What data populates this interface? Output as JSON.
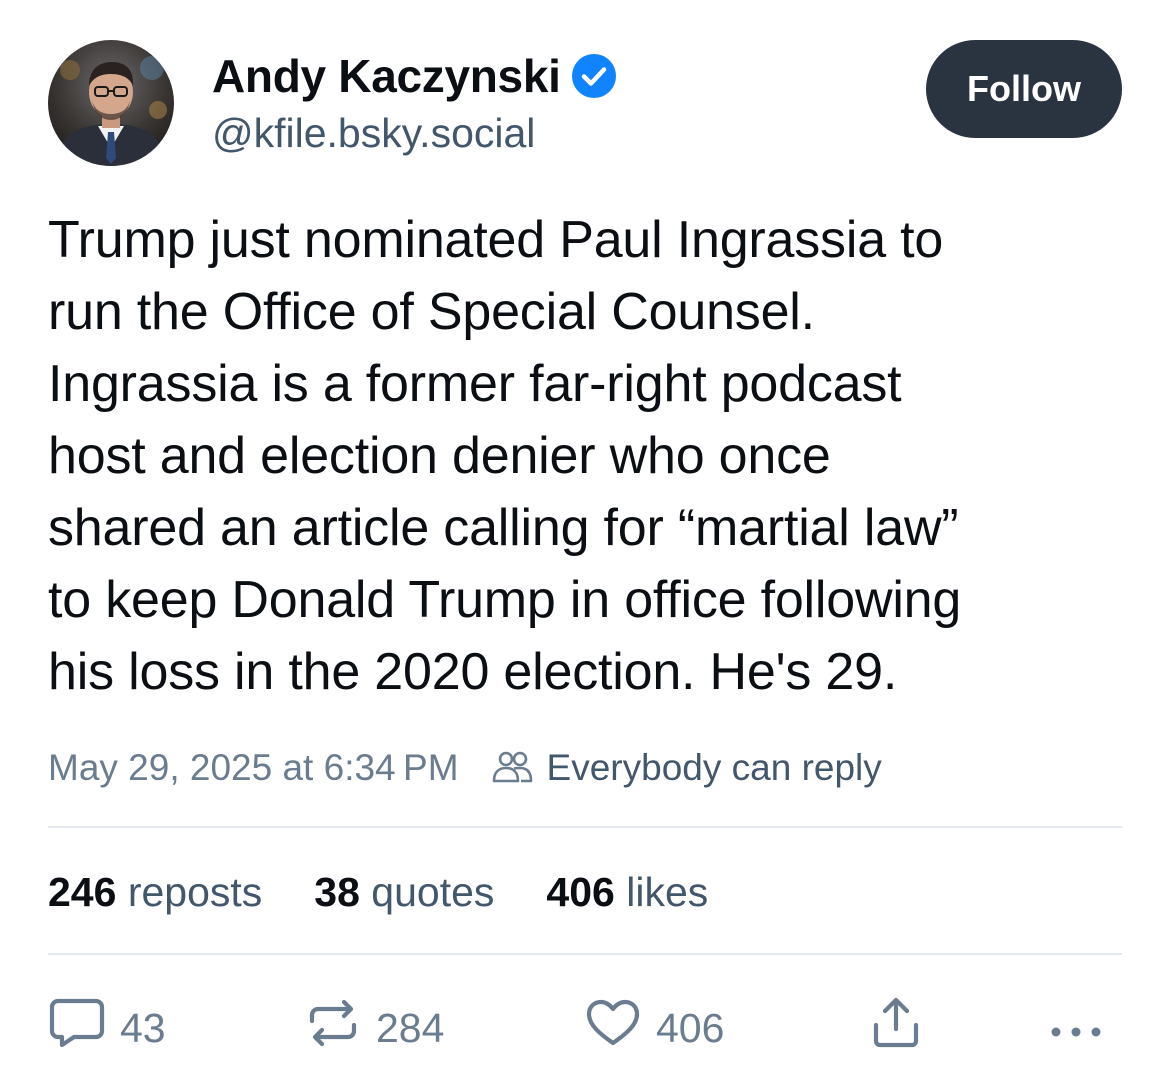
{
  "author": {
    "display_name": "Andy Kaczynski",
    "handle": "@kfile.bsky.social",
    "verified": true,
    "avatar_icon": "avatar-photo"
  },
  "follow_button": {
    "label": "Follow"
  },
  "post": {
    "text_lines": [
      "Trump just nominated Paul Ingrassia to",
      "run the Office of Special Counsel.",
      "Ingrassia is a former far-right podcast",
      "host and election denier who once",
      "shared an article calling for “martial law”",
      "to keep Donald Trump in office following",
      "his loss in the 2020 election. He's 29."
    ],
    "timestamp": "May 29, 2025 at 6:34 PM",
    "reply_setting": "Everybody can reply"
  },
  "stats": {
    "reposts_count": "246",
    "reposts_label": "reposts",
    "quotes_count": "38",
    "quotes_label": "quotes",
    "likes_count": "406",
    "likes_label": "likes"
  },
  "actions": {
    "reply_count": "43",
    "repost_count": "284",
    "like_count": "406"
  },
  "colors": {
    "accent": "#1083fe",
    "follow_bg": "#2a3440",
    "muted_text": "#6a7c8f",
    "handle_text": "#42576c",
    "divider": "#e3e8ee"
  }
}
